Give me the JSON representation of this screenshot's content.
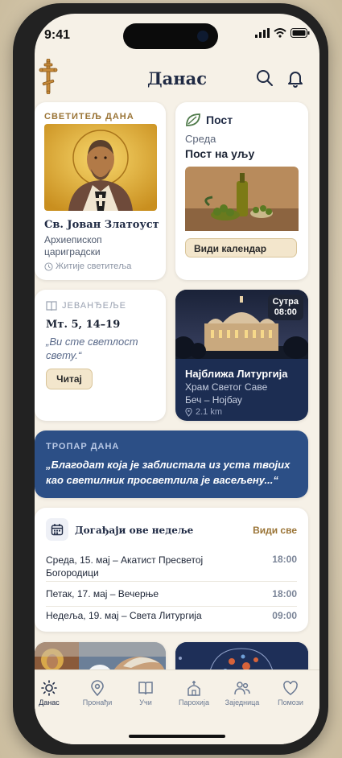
{
  "status": {
    "time": "9:41"
  },
  "header": {
    "title": "Данас"
  },
  "saint": {
    "eyebrow": "СВЕТИТЕЉ ДАНА",
    "name": "Св. Јован Златоуст",
    "role": "Архиепископ цариградски",
    "link": "Житије светитеља"
  },
  "fast": {
    "title": "Пост",
    "day": "Среда",
    "type": "Пост на уљу",
    "button": "Види календар"
  },
  "gospel": {
    "eyebrow": "ЈЕВАНЂЕЉЕ",
    "ref": "Мт. 5, 14–19",
    "quote": "„Ви сте светлост свету.“",
    "button": "Читај"
  },
  "liturgy": {
    "badge_line1": "Сутра",
    "badge_line2": "08:00",
    "title": "Најближа Литургија",
    "church": "Храм Светог Саве",
    "place": "Беч – Нојбау",
    "distance": "2.1 km"
  },
  "troparion": {
    "eyebrow": "ТРОПАР ДАНА",
    "text": "„Благодат која је заблистала из уста твојих као светилник просветлила је васељену...“"
  },
  "events": {
    "title": "Догађаји ове недеље",
    "see_all": "Види све",
    "items": [
      {
        "text": "Среда, 15. мај – Акатист Пресветој Богородици",
        "time": "18:00"
      },
      {
        "text": "Петак, 17. мај – Вечерње",
        "time": "18:00"
      },
      {
        "text": "Недеља, 19. мај – Света Литургија",
        "time": "09:00"
      }
    ]
  },
  "tabs": [
    {
      "label": "Данас",
      "icon": "sun-icon"
    },
    {
      "label": "Пронађи",
      "icon": "location-pin-icon"
    },
    {
      "label": "Учи",
      "icon": "book-icon"
    },
    {
      "label": "Парохија",
      "icon": "church-icon"
    },
    {
      "label": "Заједница",
      "icon": "people-icon"
    },
    {
      "label": "Помози",
      "icon": "heart-icon"
    }
  ],
  "colors": {
    "accent_gold": "#9a7436",
    "navy": "#1f2a44",
    "troparion_bg": "#2c4f86"
  }
}
